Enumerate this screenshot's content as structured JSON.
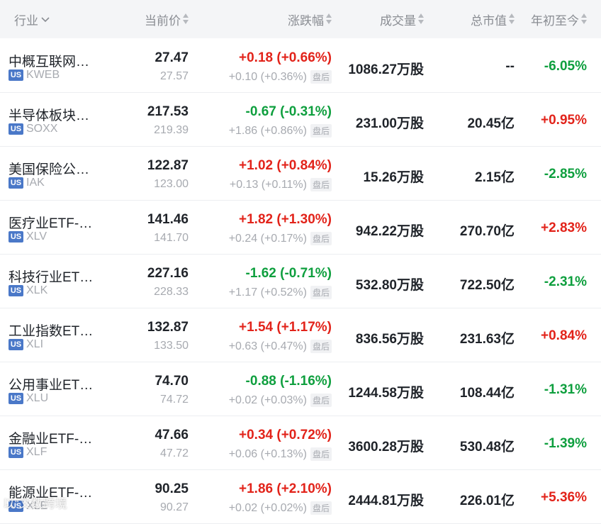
{
  "header": {
    "industry": "行业",
    "price": "当前价",
    "change": "涨跌幅",
    "volume": "成交量",
    "market_cap": "总市值",
    "ytd": "年初至今"
  },
  "after_hours_label": "盘后",
  "market_badge": "US",
  "colors": {
    "up": "#e2231a",
    "down": "#0e9f3e",
    "badge": "#4a78c8"
  },
  "rows": [
    {
      "name": "中概互联网…",
      "ticker": "KWEB",
      "price": "27.47",
      "prev": "27.57",
      "change": "+0.18 (+0.66%)",
      "change_dir": "up",
      "after": "+0.10 (+0.36%)",
      "volume": "1086.27万股",
      "cap": "--",
      "ytd": "-6.05%",
      "ytd_dir": "down"
    },
    {
      "name": "半导体板块…",
      "ticker": "SOXX",
      "price": "217.53",
      "prev": "219.39",
      "change": "-0.67 (-0.31%)",
      "change_dir": "down",
      "after": "+1.86 (+0.86%)",
      "volume": "231.00万股",
      "cap": "20.45亿",
      "ytd": "+0.95%",
      "ytd_dir": "up"
    },
    {
      "name": "美国保险公…",
      "ticker": "IAK",
      "price": "122.87",
      "prev": "123.00",
      "change": "+1.02 (+0.84%)",
      "change_dir": "up",
      "after": "+0.13 (+0.11%)",
      "volume": "15.26万股",
      "cap": "2.15亿",
      "ytd": "-2.85%",
      "ytd_dir": "down"
    },
    {
      "name": "医疗业ETF-…",
      "ticker": "XLV",
      "price": "141.46",
      "prev": "141.70",
      "change": "+1.82 (+1.30%)",
      "change_dir": "up",
      "after": "+0.24 (+0.17%)",
      "volume": "942.22万股",
      "cap": "270.70亿",
      "ytd": "+2.83%",
      "ytd_dir": "up"
    },
    {
      "name": "科技行业ET…",
      "ticker": "XLK",
      "price": "227.16",
      "prev": "228.33",
      "change": "-1.62 (-0.71%)",
      "change_dir": "down",
      "after": "+1.17 (+0.52%)",
      "volume": "532.80万股",
      "cap": "722.50亿",
      "ytd": "-2.31%",
      "ytd_dir": "down"
    },
    {
      "name": "工业指数ET…",
      "ticker": "XLI",
      "price": "132.87",
      "prev": "133.50",
      "change": "+1.54 (+1.17%)",
      "change_dir": "up",
      "after": "+0.63 (+0.47%)",
      "volume": "836.56万股",
      "cap": "231.63亿",
      "ytd": "+0.84%",
      "ytd_dir": "up"
    },
    {
      "name": "公用事业ET…",
      "ticker": "XLU",
      "price": "74.70",
      "prev": "74.72",
      "change": "-0.88 (-1.16%)",
      "change_dir": "down",
      "after": "+0.02 (+0.03%)",
      "volume": "1244.58万股",
      "cap": "108.44亿",
      "ytd": "-1.31%",
      "ytd_dir": "down"
    },
    {
      "name": "金融业ETF-…",
      "ticker": "XLF",
      "price": "47.66",
      "prev": "47.72",
      "change": "+0.34 (+0.72%)",
      "change_dir": "up",
      "after": "+0.06 (+0.13%)",
      "volume": "3600.28万股",
      "cap": "530.48亿",
      "ytd": "-1.39%",
      "ytd_dir": "down"
    },
    {
      "name": "能源业ETF-…",
      "ticker": "XLE",
      "price": "90.25",
      "prev": "90.27",
      "change": "+1.86 (+2.10%)",
      "change_dir": "up",
      "after": "+0.02 (+0.02%)",
      "volume": "2444.81万股",
      "cap": "226.01亿",
      "ytd": "+5.36%",
      "ytd_dir": "up"
    }
  ],
  "watermark": "以“文数跨境"
}
